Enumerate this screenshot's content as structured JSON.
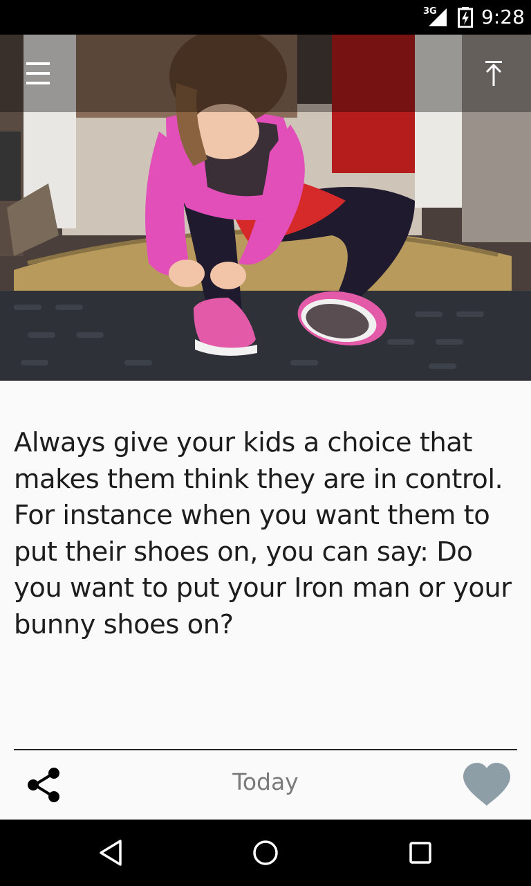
{
  "status_bar": {
    "network": "3G",
    "time": "9:28"
  },
  "toolbar": {
    "menu_icon": "hamburger-menu-icon",
    "scroll_top_icon": "arrow-to-top-icon"
  },
  "tip": {
    "text": "Always give your kids a choice that makes them think they are in control. For instance when you want them to put their shoes on, you can say: Do you want to put your Iron man or your bunny shoes on?"
  },
  "footer": {
    "date_label": "Today",
    "share_icon": "share-icon",
    "like_icon": "heart-icon",
    "like_color": "#8e9ea6"
  },
  "nav_bar": {
    "back_icon": "triangle-back-icon",
    "home_icon": "circle-home-icon",
    "recents_icon": "square-recents-icon"
  }
}
